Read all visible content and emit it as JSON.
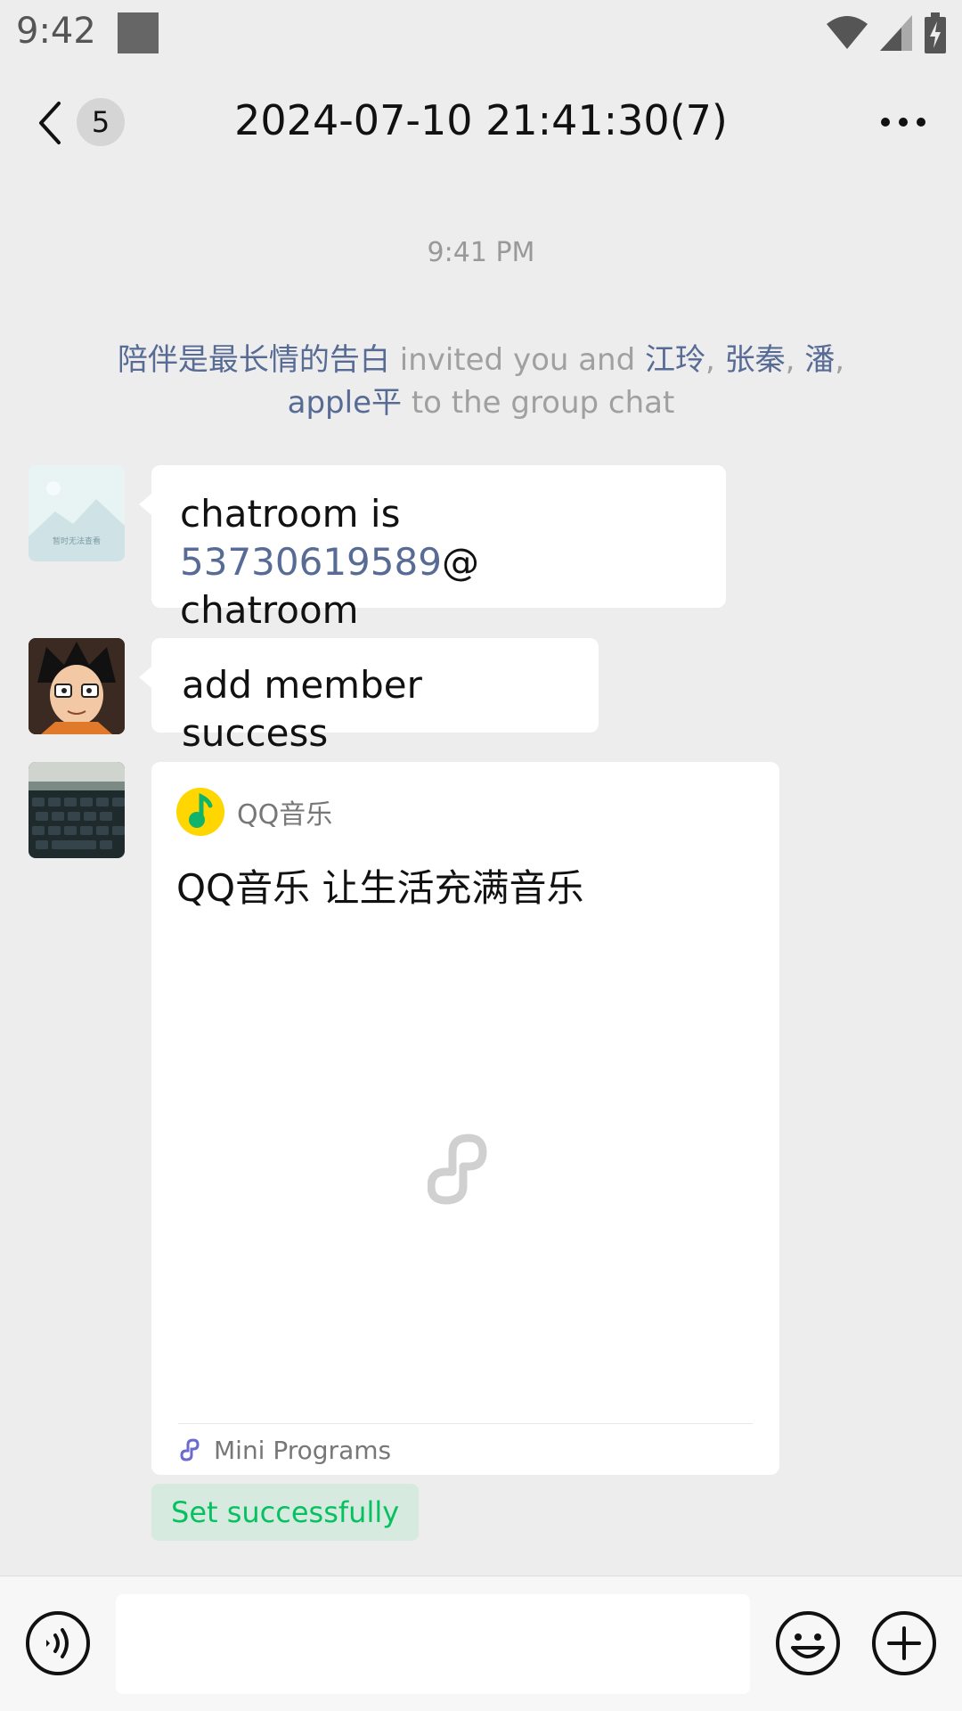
{
  "status_bar": {
    "time": "9:42"
  },
  "header": {
    "unread_count": "5",
    "title": "2024-07-10 21:41:30(7)"
  },
  "chat": {
    "timestamp": "9:41 PM",
    "system_note": {
      "inviter": "陪伴是最长情的告白",
      "text_invited": " invited you and ",
      "member_1": "江玲",
      "sep_1": ", ",
      "member_2": "张秦",
      "sep_2": ", ",
      "member_3": "潘",
      "sep_3": ", ",
      "member_4": "apple平",
      "text_end": " to the group chat"
    },
    "messages": [
      {
        "text_before": "chatroom is ",
        "link": "53730619589",
        "text_after_1": "@",
        "text_after_2": "chatroom",
        "avatar_text": "暂时无法查看"
      },
      {
        "text": "add member success"
      }
    ],
    "mini_program": {
      "app_name": "QQ音乐",
      "title": "QQ音乐 让生活充满音乐",
      "footer_label": "Mini Programs"
    },
    "success_tag": "Set successfully"
  },
  "bottom_bar": {
    "input_value": ""
  },
  "colors": {
    "link": "#576b95",
    "success_green": "#07c160",
    "background": "#ededed"
  }
}
